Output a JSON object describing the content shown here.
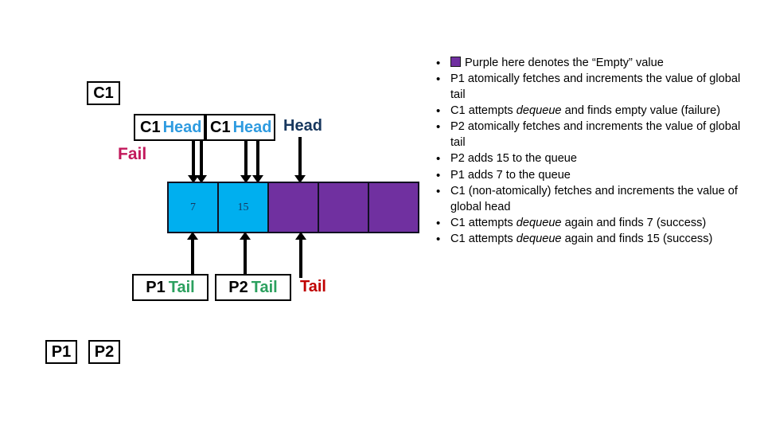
{
  "diagram": {
    "actors": {
      "c1_top": "C1",
      "p1": "P1",
      "p2": "P2"
    },
    "head_pointers": [
      {
        "owner": "C1",
        "label": "Head",
        "boxed": true,
        "clipped": true
      },
      {
        "owner": "C1",
        "label": "Head",
        "boxed": true,
        "clipped": false
      },
      {
        "owner": "",
        "label": "Head",
        "boxed": false,
        "clipped": false
      }
    ],
    "tail_pointers": [
      {
        "owner": "P1",
        "label": "Tail",
        "boxed": true
      },
      {
        "owner": "P2",
        "label": "Tail",
        "boxed": true
      },
      {
        "owner": "",
        "label": "Tail",
        "boxed": false
      }
    ],
    "status_label": "Fail",
    "queue": {
      "cells": [
        {
          "value": "7",
          "state": "filled"
        },
        {
          "value": "15",
          "state": "filled"
        },
        {
          "value": "",
          "state": "empty"
        },
        {
          "value": "",
          "state": "empty"
        },
        {
          "value": "",
          "state": "empty"
        }
      ]
    },
    "colors": {
      "filled_cell": "#00AFEF",
      "empty_cell": "#7030A0",
      "head_text": "#2E9BE0",
      "head_plain_text": "#17375E",
      "tail_text": "#2BA05E",
      "tail_plain_text": "#C00000",
      "fail_text": "#C2185B",
      "cell_value_text": "#17375E"
    }
  },
  "notes": {
    "bullet_char": "•",
    "items": [
      {
        "swatch": true,
        "html": "Purple here denotes the “Empty” value"
      },
      {
        "swatch": false,
        "html": "P1 atomically fetches and increments the value of global tail"
      },
      {
        "swatch": false,
        "html": "C1 attempts <i>dequeue</i> and finds empty value (failure)"
      },
      {
        "swatch": false,
        "html": "P2 atomically fetches and increments the value of global tail"
      },
      {
        "swatch": false,
        "html": "P2 adds 15 to the queue"
      },
      {
        "swatch": false,
        "html": "P1 adds 7 to the queue"
      },
      {
        "swatch": false,
        "html": "C1 (non-atomically) fetches and increments the value of global head"
      },
      {
        "swatch": false,
        "html": "C1 attempts <i>dequeue</i> again and finds 7 (success)"
      },
      {
        "swatch": false,
        "html": "C1 attempts <i>dequeue</i> again and finds 15 (success)"
      }
    ]
  }
}
